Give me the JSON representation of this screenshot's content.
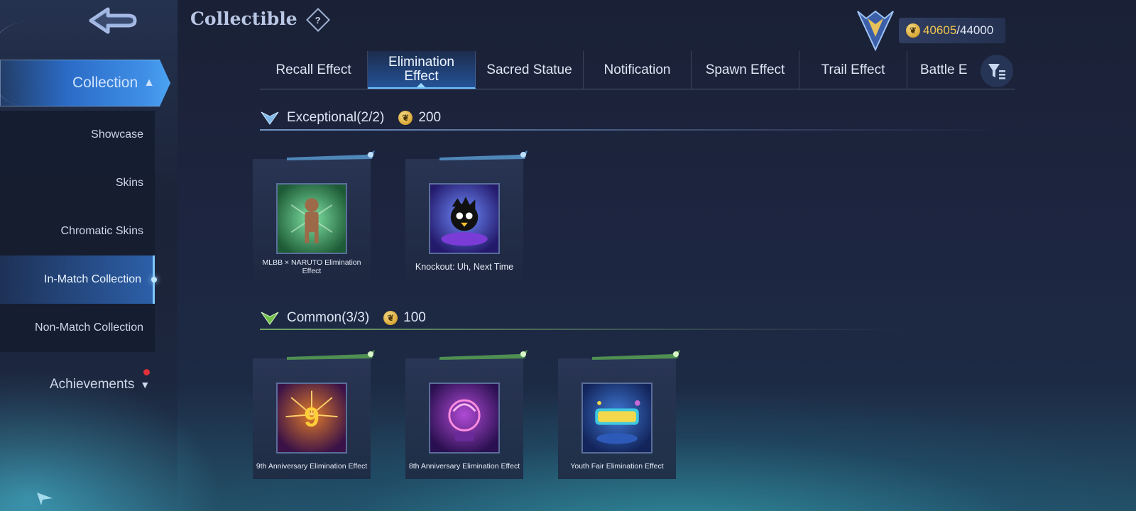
{
  "header": {
    "title": "Collectible",
    "help_icon": "help-icon",
    "points_current": "40605",
    "points_max": "/44000"
  },
  "sidebar": {
    "collection_label": "Collection",
    "items": [
      {
        "label": "Showcase",
        "active": false
      },
      {
        "label": "Skins",
        "active": false
      },
      {
        "label": "Chromatic Skins",
        "active": false
      },
      {
        "label": "In-Match Collection",
        "active": true
      },
      {
        "label": "Non-Match Collection",
        "active": false
      }
    ],
    "achievements_label": "Achievements"
  },
  "tabs": [
    {
      "label": "Recall Effect",
      "active": false
    },
    {
      "label": "Elimination Effect",
      "active": true
    },
    {
      "label": "Sacred Statue",
      "active": false
    },
    {
      "label": "Notification",
      "active": false
    },
    {
      "label": "Spawn Effect",
      "active": false
    },
    {
      "label": "Trail Effect",
      "active": false
    },
    {
      "label": "Battle E",
      "active": false
    }
  ],
  "sections": {
    "exceptional": {
      "title": "Exceptional",
      "count": "(2/2)",
      "points": "200",
      "items": [
        {
          "label": "MLBB × NARUTO Elimination Effect"
        },
        {
          "label": "Knockout: Uh, Next Time"
        }
      ]
    },
    "common": {
      "title": "Common",
      "count": "(3/3)",
      "points": "100",
      "items": [
        {
          "label": "9th Anniversary Elimination Effect"
        },
        {
          "label": "8th Anniversary Elimination Effect"
        },
        {
          "label": "Youth Fair Elimination Effect"
        }
      ]
    }
  },
  "colors": {
    "accent_blue": "#3f8fe6",
    "gold": "#f0c64e",
    "exceptional": "#7fb8e8",
    "common": "#6fbf4a"
  }
}
